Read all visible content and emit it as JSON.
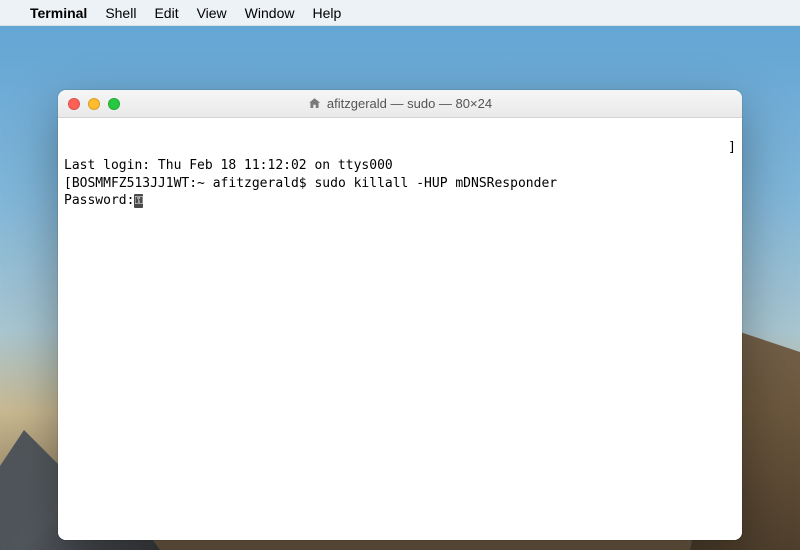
{
  "menubar": {
    "app_name": "Terminal",
    "items": [
      "Shell",
      "Edit",
      "View",
      "Window",
      "Help"
    ]
  },
  "window": {
    "title": "afitzgerald — sudo — 80×24"
  },
  "terminal": {
    "last_login": "Last login: Thu Feb 18 11:12:02 on ttys000",
    "prompt_open": "[",
    "host_path": "BOSMMFZ513JJ1WT:~ afitzgerald$ ",
    "command": "sudo killall -HUP mDNSResponder",
    "prompt_close": "]",
    "password_label": "Password:",
    "key_glyph": "⚿"
  }
}
